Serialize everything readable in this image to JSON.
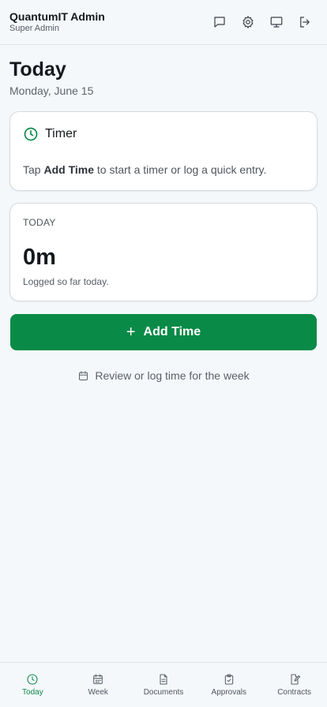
{
  "header": {
    "title": "QuantumIT Admin",
    "subtitle": "Super Admin",
    "icons": [
      "message-icon",
      "gear-icon",
      "monitor-icon",
      "logout-icon"
    ]
  },
  "page": {
    "title": "Today",
    "date": "Monday, June 15"
  },
  "timer_card": {
    "label": "Timer",
    "hint_prefix": "Tap ",
    "hint_bold": "Add Time",
    "hint_suffix": " to start a timer or log a quick entry."
  },
  "today_card": {
    "caption": "TODAY",
    "total": "0m",
    "note": "Logged so far today."
  },
  "add_button": {
    "icon": "+",
    "label": "Add Time"
  },
  "week_link": {
    "label": "Review or log time for the week"
  },
  "tabs": [
    {
      "label": "Today",
      "icon": "clock-icon",
      "active": true
    },
    {
      "label": "Week",
      "icon": "calendar-icon",
      "active": false
    },
    {
      "label": "Documents",
      "icon": "document-icon",
      "active": false
    },
    {
      "label": "Approvals",
      "icon": "clipboard-check-icon",
      "active": false
    },
    {
      "label": "Contracts",
      "icon": "file-edit-icon",
      "active": false
    }
  ],
  "colors": {
    "accent": "#0a8a47",
    "background": "#f5f8fb"
  }
}
